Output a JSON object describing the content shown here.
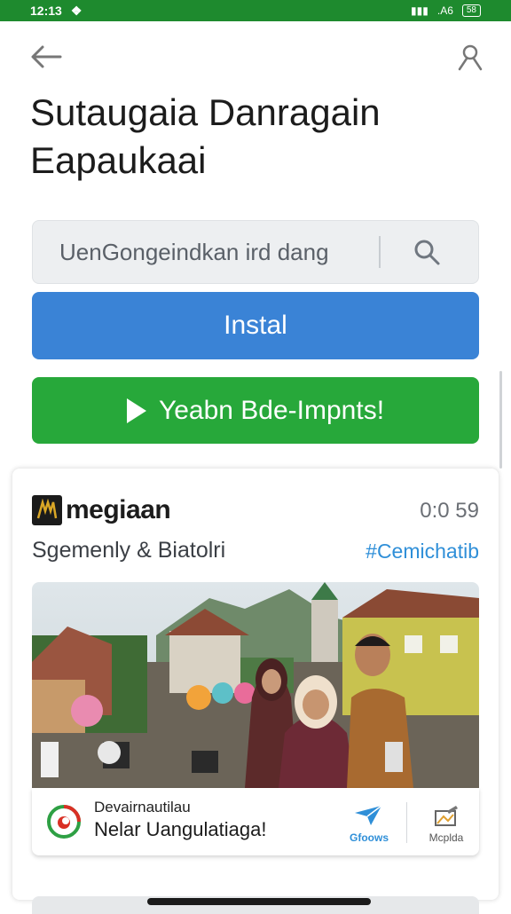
{
  "status_bar": {
    "time": "12:13",
    "network": ".A6",
    "battery": "58"
  },
  "header": {
    "title_line1": "Sutaugaia Danragain",
    "title_line2": "Eapaukaai"
  },
  "search": {
    "value": "UenGongeindkan ird dang"
  },
  "buttons": {
    "install_label": "Instal",
    "play_label": "Yeabn Bde-Impnts!"
  },
  "card": {
    "brand_name": "megiaan",
    "time": "0:0 59",
    "subtitle": "Sgemenly & Biatolri",
    "hashtag": "#Cemichatib",
    "footer_line1": "Devairnautilau",
    "footer_line2": "Nelar Uangulatiaga!",
    "share_label": "Gfoows",
    "media_label": "Mcplda"
  },
  "colors": {
    "status_bar": "#1e8a2e",
    "install_button": "#3a83d6",
    "play_button": "#27a83a",
    "hashtag": "#2f8fd8"
  },
  "icons": {
    "back": "arrow-left",
    "profile": "person-outline",
    "search": "magnifier",
    "play": "play-triangle",
    "share": "paper-plane",
    "media": "image-edit"
  }
}
